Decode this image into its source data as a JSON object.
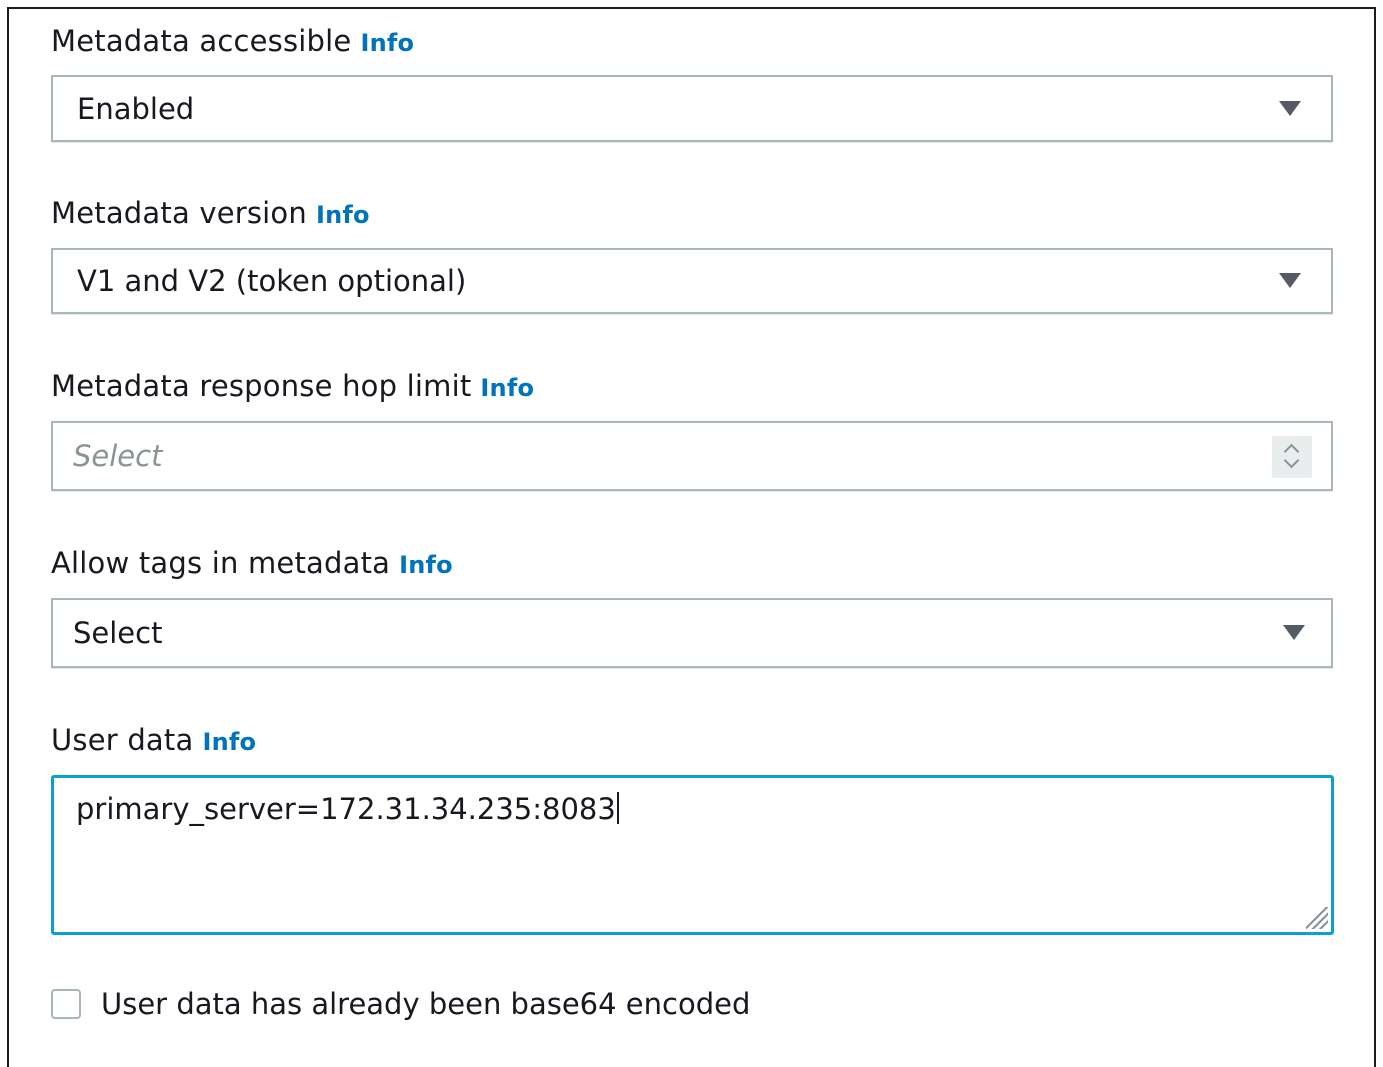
{
  "fields": {
    "metadata_accessible": {
      "label": "Metadata accessible",
      "info": "Info",
      "value": "Enabled"
    },
    "metadata_version": {
      "label": "Metadata version",
      "info": "Info",
      "value": "V1 and V2 (token optional)"
    },
    "hop_limit": {
      "label": "Metadata response hop limit",
      "info": "Info",
      "placeholder": "Select"
    },
    "allow_tags": {
      "label": "Allow tags in metadata",
      "info": "Info",
      "value": "Select"
    },
    "user_data": {
      "label": "User data",
      "info": "Info",
      "value": "primary_server=172.31.34.235:8083"
    },
    "base64_checkbox": {
      "label": "User data has already been base64 encoded",
      "checked": false
    }
  },
  "colors": {
    "info_link": "#0073bb",
    "focus_border": "#0aa0d6",
    "input_border": "#aab7b8"
  },
  "icons": {
    "dropdown": "caret-down-icon",
    "stepper": "stepper-icon",
    "resize": "resize-grip-icon"
  }
}
